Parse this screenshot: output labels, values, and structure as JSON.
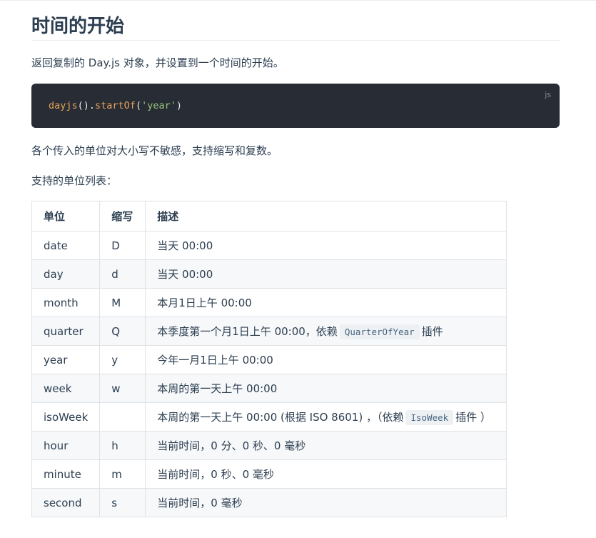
{
  "page": {
    "title": "时间的开始",
    "intro": "返回复制的 Day.js 对象，并设置到一个时间的开始。",
    "note": "各个传入的单位对大小写不敏感，支持缩写和复数。",
    "list_caption": "支持的单位列表："
  },
  "code_block": {
    "lang": "js",
    "tokens": [
      "dayjs",
      "().",
      "startOf",
      "(",
      "'year'",
      ")"
    ]
  },
  "table": {
    "headers": [
      "单位",
      "缩写",
      "描述"
    ],
    "rows": [
      {
        "unit": "date",
        "abbr": "D",
        "desc": "当天 00:00"
      },
      {
        "unit": "day",
        "abbr": "d",
        "desc": "当天 00:00"
      },
      {
        "unit": "month",
        "abbr": "M",
        "desc": "本月1日上午 00:00"
      },
      {
        "unit": "quarter",
        "abbr": "Q",
        "desc_pre": "本季度第一个月1日上午 00:00，依赖",
        "desc_code": "QuarterOfYear",
        "desc_post": "插件"
      },
      {
        "unit": "year",
        "abbr": "y",
        "desc": "今年一月1日上午 00:00"
      },
      {
        "unit": "week",
        "abbr": "w",
        "desc": "本周的第一天上午 00:00"
      },
      {
        "unit": "isoWeek",
        "abbr": "",
        "desc_pre": "本周的第一天上午 00:00 (根据 ISO 8601) ，（依赖",
        "desc_code": "IsoWeek",
        "desc_post": "插件 ）"
      },
      {
        "unit": "hour",
        "abbr": "h",
        "desc": "当前时间，0 分、0 秒、0 毫秒"
      },
      {
        "unit": "minute",
        "abbr": "m",
        "desc": "当前时间，0 秒、0 毫秒"
      },
      {
        "unit": "second",
        "abbr": "s",
        "desc": "当前时间，0 毫秒"
      }
    ]
  }
}
